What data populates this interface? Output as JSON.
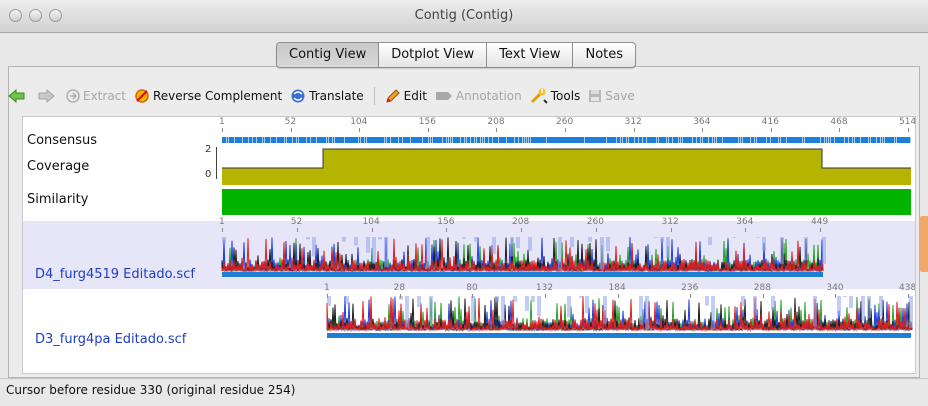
{
  "window": {
    "title": "Contig (Contig)"
  },
  "tabs": [
    {
      "label": "Contig View",
      "active": true
    },
    {
      "label": "Dotplot View",
      "active": false
    },
    {
      "label": "Text View",
      "active": false
    },
    {
      "label": "Notes",
      "active": false
    }
  ],
  "toolbar": {
    "extract": "Extract",
    "reverse_complement": "Reverse Complement",
    "translate": "Translate",
    "edit": "Edit",
    "annotation": "Annotation",
    "tools": "Tools",
    "save": "Save"
  },
  "rows": {
    "consensus": "Consensus",
    "coverage": "Coverage",
    "coverage_max": "2",
    "coverage_min": "0",
    "similarity": "Similarity"
  },
  "rulers": {
    "consensus_ticks": [
      "1",
      "52",
      "104",
      "156",
      "208",
      "260",
      "312",
      "364",
      "416",
      "468",
      "514"
    ],
    "read1_ticks": [
      "1",
      "52",
      "104",
      "156",
      "208",
      "260",
      "312",
      "364",
      "449"
    ],
    "read2_ticks": [
      "1",
      "28",
      "80",
      "132",
      "184",
      "236",
      "288",
      "340",
      "438"
    ]
  },
  "reads": [
    {
      "name": "D4_furg4519 Editado.scf"
    },
    {
      "name": "D3_furg4pa Editado.scf"
    }
  ],
  "status": {
    "text": "Cursor before residue 330 (original residue 254)"
  },
  "colors": {
    "consensus_bar": "#1e7fd8",
    "coverage_fill": "#b5b400",
    "similarity_fill": "#00b400",
    "read1_bg": "#e6e6f8",
    "trace_a": "#2aa02a",
    "trace_c": "#2040e0",
    "trace_g": "#202020",
    "trace_t": "#e02020"
  }
}
